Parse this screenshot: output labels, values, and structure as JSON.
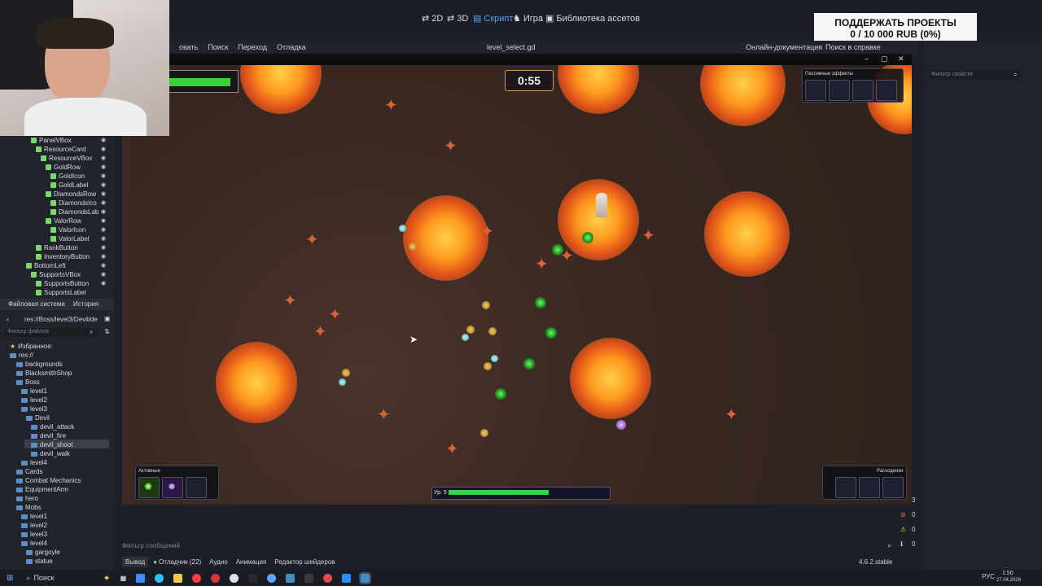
{
  "window": {
    "title": "level_select.gd"
  },
  "workspaces": [
    {
      "label": "2D"
    },
    {
      "label": "3D"
    },
    {
      "label": "Скрипт"
    },
    {
      "label": "Игра"
    },
    {
      "label": "Библиотека ассетов"
    }
  ],
  "donate": {
    "line1": "ПОДДЕРЖАТЬ ПРОЕКТЫ",
    "line2": "0 / 10 000 RUB (0%)"
  },
  "menu": {
    "items": [
      "овать",
      "Поиск",
      "Переход",
      "Отладка"
    ],
    "online_docs": "Онлайн-документация",
    "help_search": "Поиск в справке"
  },
  "scene_tree": [
    "PanelVBox",
    "ResourceCard",
    "ResourceVBox",
    "GoldRow",
    "GoldIcon",
    "GoldLabel",
    "DiamondsRow",
    "DiamondsIco",
    "DiamondsLab",
    "ValorRow",
    "ValorIcon",
    "ValorLabel",
    "RankButton",
    "InventoryButton",
    "BottomLeft",
    "SupportsVBox",
    "SupportsButton",
    "SupportsLabel"
  ],
  "filesystem": {
    "tabs": [
      "Файловая система",
      "История"
    ],
    "path": "res://Boss/level3/Devil/de",
    "filter_placeholder": "Фильтр файлов",
    "items": [
      "Избранное:",
      "res://",
      "backgrounds",
      "BlacksmithShop",
      "Boss",
      "level1",
      "level2",
      "level3",
      "Devil",
      "devil_attack",
      "devil_fire",
      "devil_shoot",
      "devil_walk",
      "level4",
      "Cards",
      "Combat Mechanics",
      "EquipmentArm",
      "hero",
      "Mobs",
      "level1",
      "level2",
      "level3",
      "level4",
      "gargoyle",
      "statue"
    ]
  },
  "game": {
    "timer": "0:55",
    "hp_fraction": 0.95,
    "passive_title": "Пассивные эффекты",
    "active_title": "Активные",
    "consumables_title": "Расходники",
    "level_label": "Ур. 5",
    "xp_fraction": 0.63
  },
  "inspector": {
    "filter_placeholder": "Фильтр свойств"
  },
  "bottom": {
    "messages_placeholder": "Фильтр сообщений",
    "tabs": [
      "Вывод",
      "Отладчик (22)",
      "Аудио",
      "Анимация",
      "Редактор шейдеров"
    ],
    "version": "4.6.2.stable",
    "counts": [
      "3",
      "0",
      "0",
      "0"
    ]
  },
  "taskbar": {
    "search": "Поиск",
    "lang": "РУС",
    "time": "1:50",
    "date": "27.04.2026"
  },
  "colors": {
    "accent": "#58a6ff",
    "hp": "#3ad13a",
    "xp": "#2fd64b",
    "fire": "#ff9a1e"
  }
}
